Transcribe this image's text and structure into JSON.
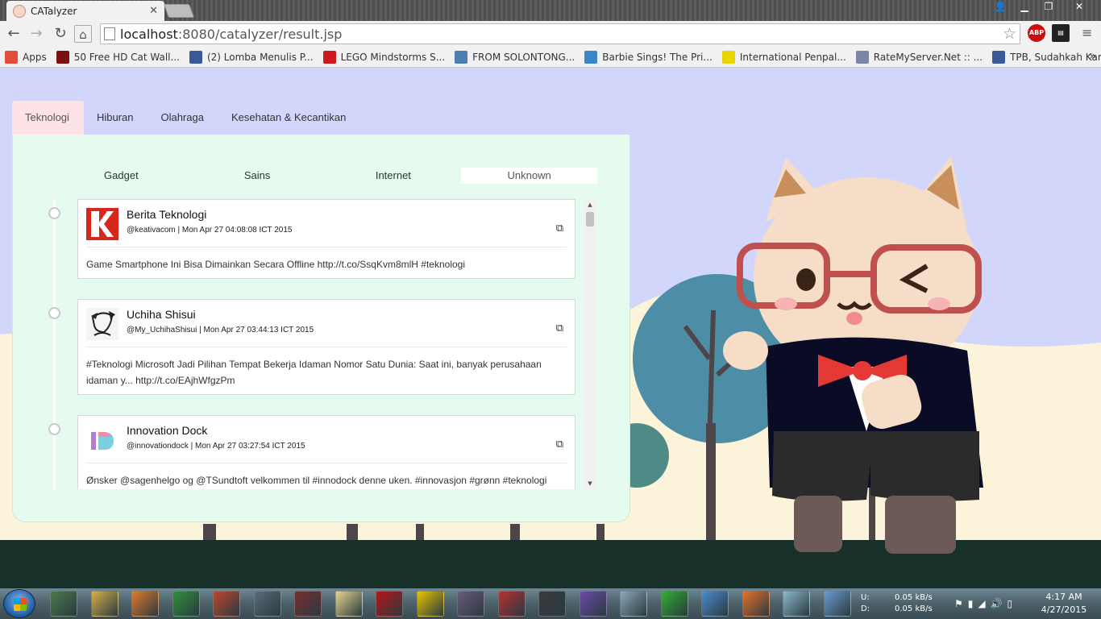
{
  "browser": {
    "tab_title": "CATalyzer",
    "url_host": "localhost",
    "url_path": ":8080/catalyzer/result.jsp",
    "nav_icons": [
      "back-icon",
      "forward-icon",
      "reload-icon",
      "home-icon"
    ],
    "extensions": [
      {
        "name": "ABP",
        "badge": "1",
        "color": "#c70d0d"
      },
      {
        "name": "ext2",
        "badge": "4",
        "color": "#222222"
      }
    ]
  },
  "bookmarks": [
    {
      "label": "Apps",
      "icon": "apps-icon",
      "color": "#e24c3b"
    },
    {
      "label": "50 Free HD Cat Wall...",
      "icon": "pinterest-icon",
      "color": "#7a1010"
    },
    {
      "label": "(2) Lomba Menulis P...",
      "icon": "facebook-icon",
      "color": "#3b5998"
    },
    {
      "label": "LEGO Mindstorms S...",
      "icon": "youtube-icon",
      "color": "#cc181e"
    },
    {
      "label": "FROM SOLONTONG...",
      "icon": "wordpress-icon",
      "color": "#4a7fb0"
    },
    {
      "label": "Barbie Sings! The Pri...",
      "icon": "t-icon",
      "color": "#3a86c8"
    },
    {
      "label": "International Penpal...",
      "icon": "penpal-icon",
      "color": "#e8d400"
    },
    {
      "label": "RateMyServer.Net :: ...",
      "icon": "rms-icon",
      "color": "#7a86a8"
    },
    {
      "label": "TPB, Sudahkah Kam...",
      "icon": "facebook-icon",
      "color": "#3b5998"
    }
  ],
  "categories": [
    "Teknologi",
    "Hiburan",
    "Olahraga",
    "Kesehatan & Kecantikan"
  ],
  "active_category": "Teknologi",
  "subcategories": [
    "Gadget",
    "Sains",
    "Internet",
    "Unknown"
  ],
  "active_subcategory": "Unknown",
  "tweets": [
    {
      "name": "Berita Teknologi",
      "meta": "@keativacom | Mon Apr 27 04:08:08 ICT 2015",
      "text": "Game Smartphone Ini Bisa Dimainkan Secara Offline http://t.co/SsqKvm8mlH #teknologi",
      "avatar": "k-logo-avatar"
    },
    {
      "name": "Uchiha Shisui",
      "meta": "@My_UchihaShisui | Mon Apr 27 03:44:13 ICT 2015",
      "text": "#Teknologi Microsoft Jadi Pilihan Tempat Bekerja Idaman Nomor Satu Dunia: Saat ini, banyak perusahaan idaman y... http://t.co/EAjhWfgzPm",
      "avatar": "sketch-avatar"
    },
    {
      "name": "Innovation Dock",
      "meta": "@innovationdock | Mon Apr 27 03:27:54 ICT 2015",
      "text": "Ønsker @sagenhelgo og @TSundtoft velkommen til #innodock denne uken. #innovasjon #grønn #teknologi",
      "avatar": "id-logo-avatar"
    }
  ],
  "taskbar": {
    "net_up_label": "U:",
    "net_down_label": "D:",
    "net_up": "0.05 kB/s",
    "net_down": "0.05 kB/s",
    "time": "4:17 AM",
    "date": "4/27/2015"
  },
  "colors": {
    "page_bg": "#d3d6fb",
    "panel_bg": "#e5fbef",
    "active_tab_bg": "#fde3e5",
    "ground": "#173029"
  }
}
